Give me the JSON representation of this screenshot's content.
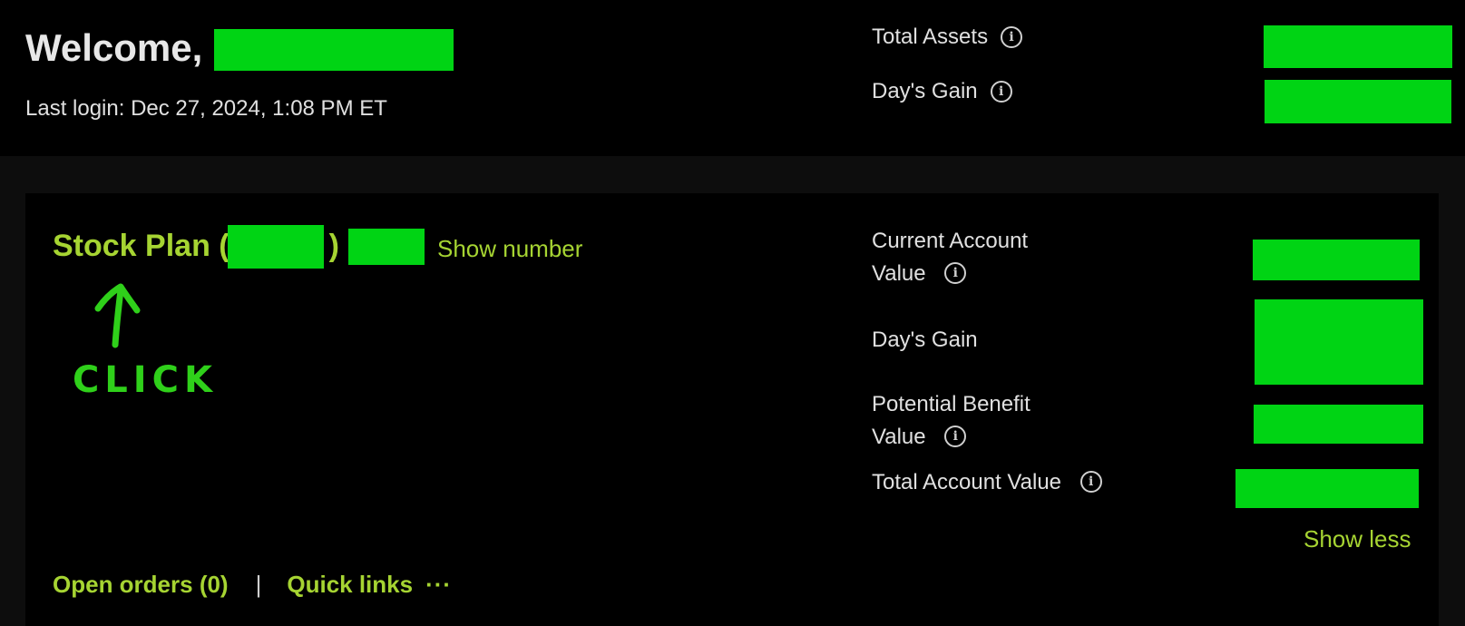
{
  "header": {
    "welcome": "Welcome,",
    "last_login": "Last login: Dec 27, 2024, 1:08 PM ET",
    "total_assets_label": "Total Assets",
    "days_gain_label": "Day's Gain"
  },
  "plan": {
    "title_prefix": "Stock Plan (",
    "title_close": ") -",
    "show_number": "Show number",
    "annotation_text": "CLICK"
  },
  "account": {
    "current_value_line1": "Current Account",
    "current_value_line2": "Value",
    "days_gain": "Day's Gain",
    "potential_benefit_line1": "Potential Benefit",
    "potential_benefit_line2": "Value",
    "total_account_value": "Total Account Value",
    "show_less": "Show less"
  },
  "footer": {
    "open_orders": "Open orders (0)",
    "separator": "|",
    "quick_links": "Quick links",
    "quick_links_more": "···"
  },
  "colors": {
    "background": "#000000",
    "band": "#0d0d0d",
    "accent": "#a6d432",
    "redaction": "#00d414",
    "text": "#e0e0e0"
  },
  "icons": {
    "info": "info-circle-icon",
    "more": "more-horizontal-icon"
  }
}
